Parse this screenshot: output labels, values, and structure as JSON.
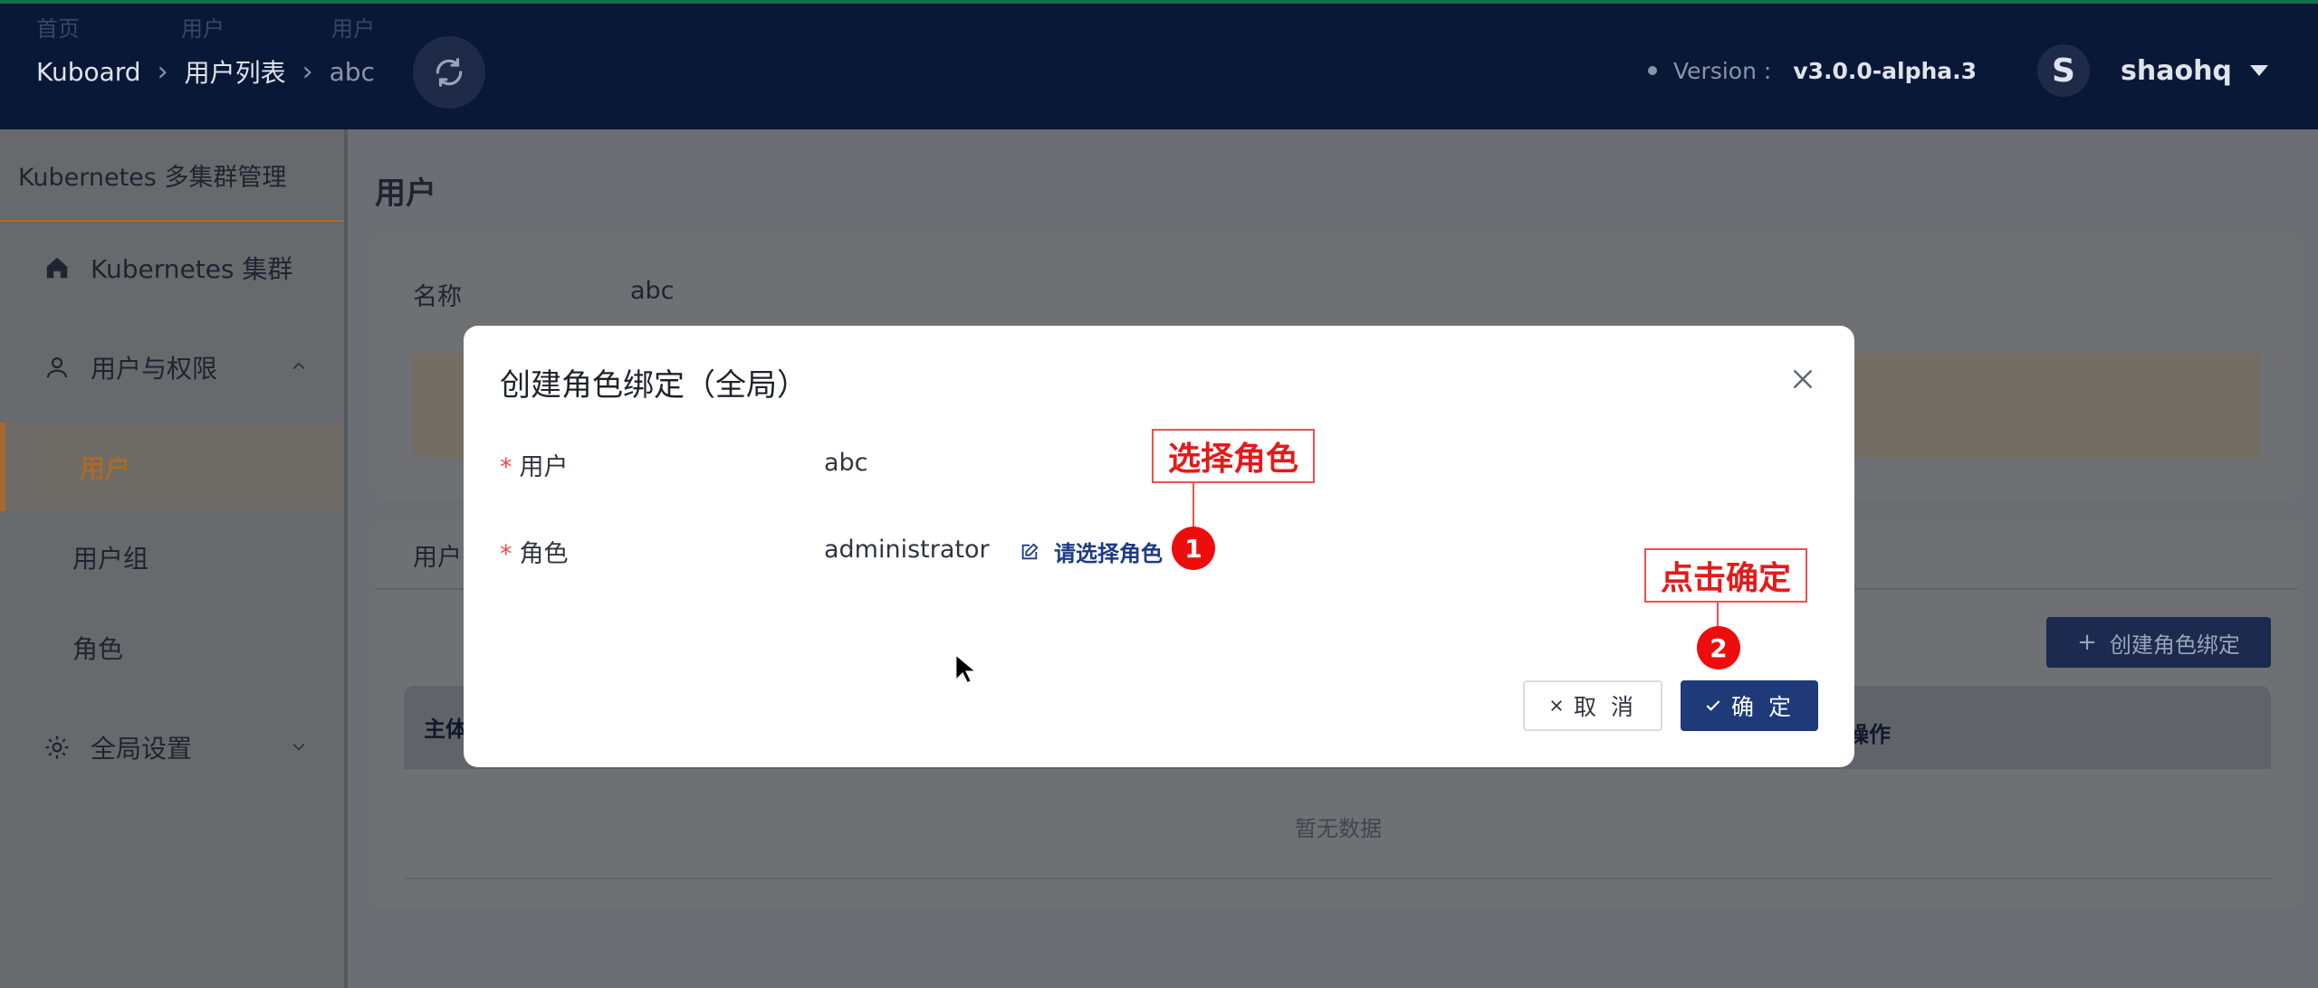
{
  "header": {
    "crumb_tips": [
      "首页",
      "用户",
      "用户"
    ],
    "breadcrumb": [
      "Kuboard",
      "用户列表",
      "abc"
    ],
    "version_label": "Version :",
    "version_value": "v3.0.0-alpha.3",
    "avatar_letter": "S",
    "username": "shaohq"
  },
  "sidebar": {
    "title": "Kubernetes 多集群管理",
    "items": [
      {
        "label": "Kubernetes 集群",
        "icon": "home-icon"
      },
      {
        "label": "用户与权限",
        "icon": "user-icon"
      },
      {
        "label": "全局设置",
        "icon": "gear-icon"
      }
    ],
    "subitems": [
      "用户",
      "用户组",
      "角色"
    ],
    "active_subitem": "用户"
  },
  "main": {
    "page_title": "用户",
    "name_label": "名称",
    "name_value": "abc",
    "tab_label": "用户",
    "create_button": "创建角色绑定",
    "table_headers": [
      "主体",
      "操作"
    ],
    "empty_text": "暂无数据"
  },
  "dialog": {
    "title": "创建角色绑定（全局）",
    "user_label": "用户",
    "user_value": "abc",
    "role_label": "角色",
    "role_value": "administrator",
    "select_role_link": "请选择角色",
    "cancel_button": "取 消",
    "ok_button": "确 定"
  },
  "annotations": {
    "callout1": "选择角色",
    "badge1": "1",
    "callout2": "点击确定",
    "badge2": "2"
  },
  "colors": {
    "header_bg": "#0a1838",
    "accent_orange": "#a86a2c",
    "primary_button": "#1f3a78",
    "annotation_red": "#ee0d0d"
  }
}
